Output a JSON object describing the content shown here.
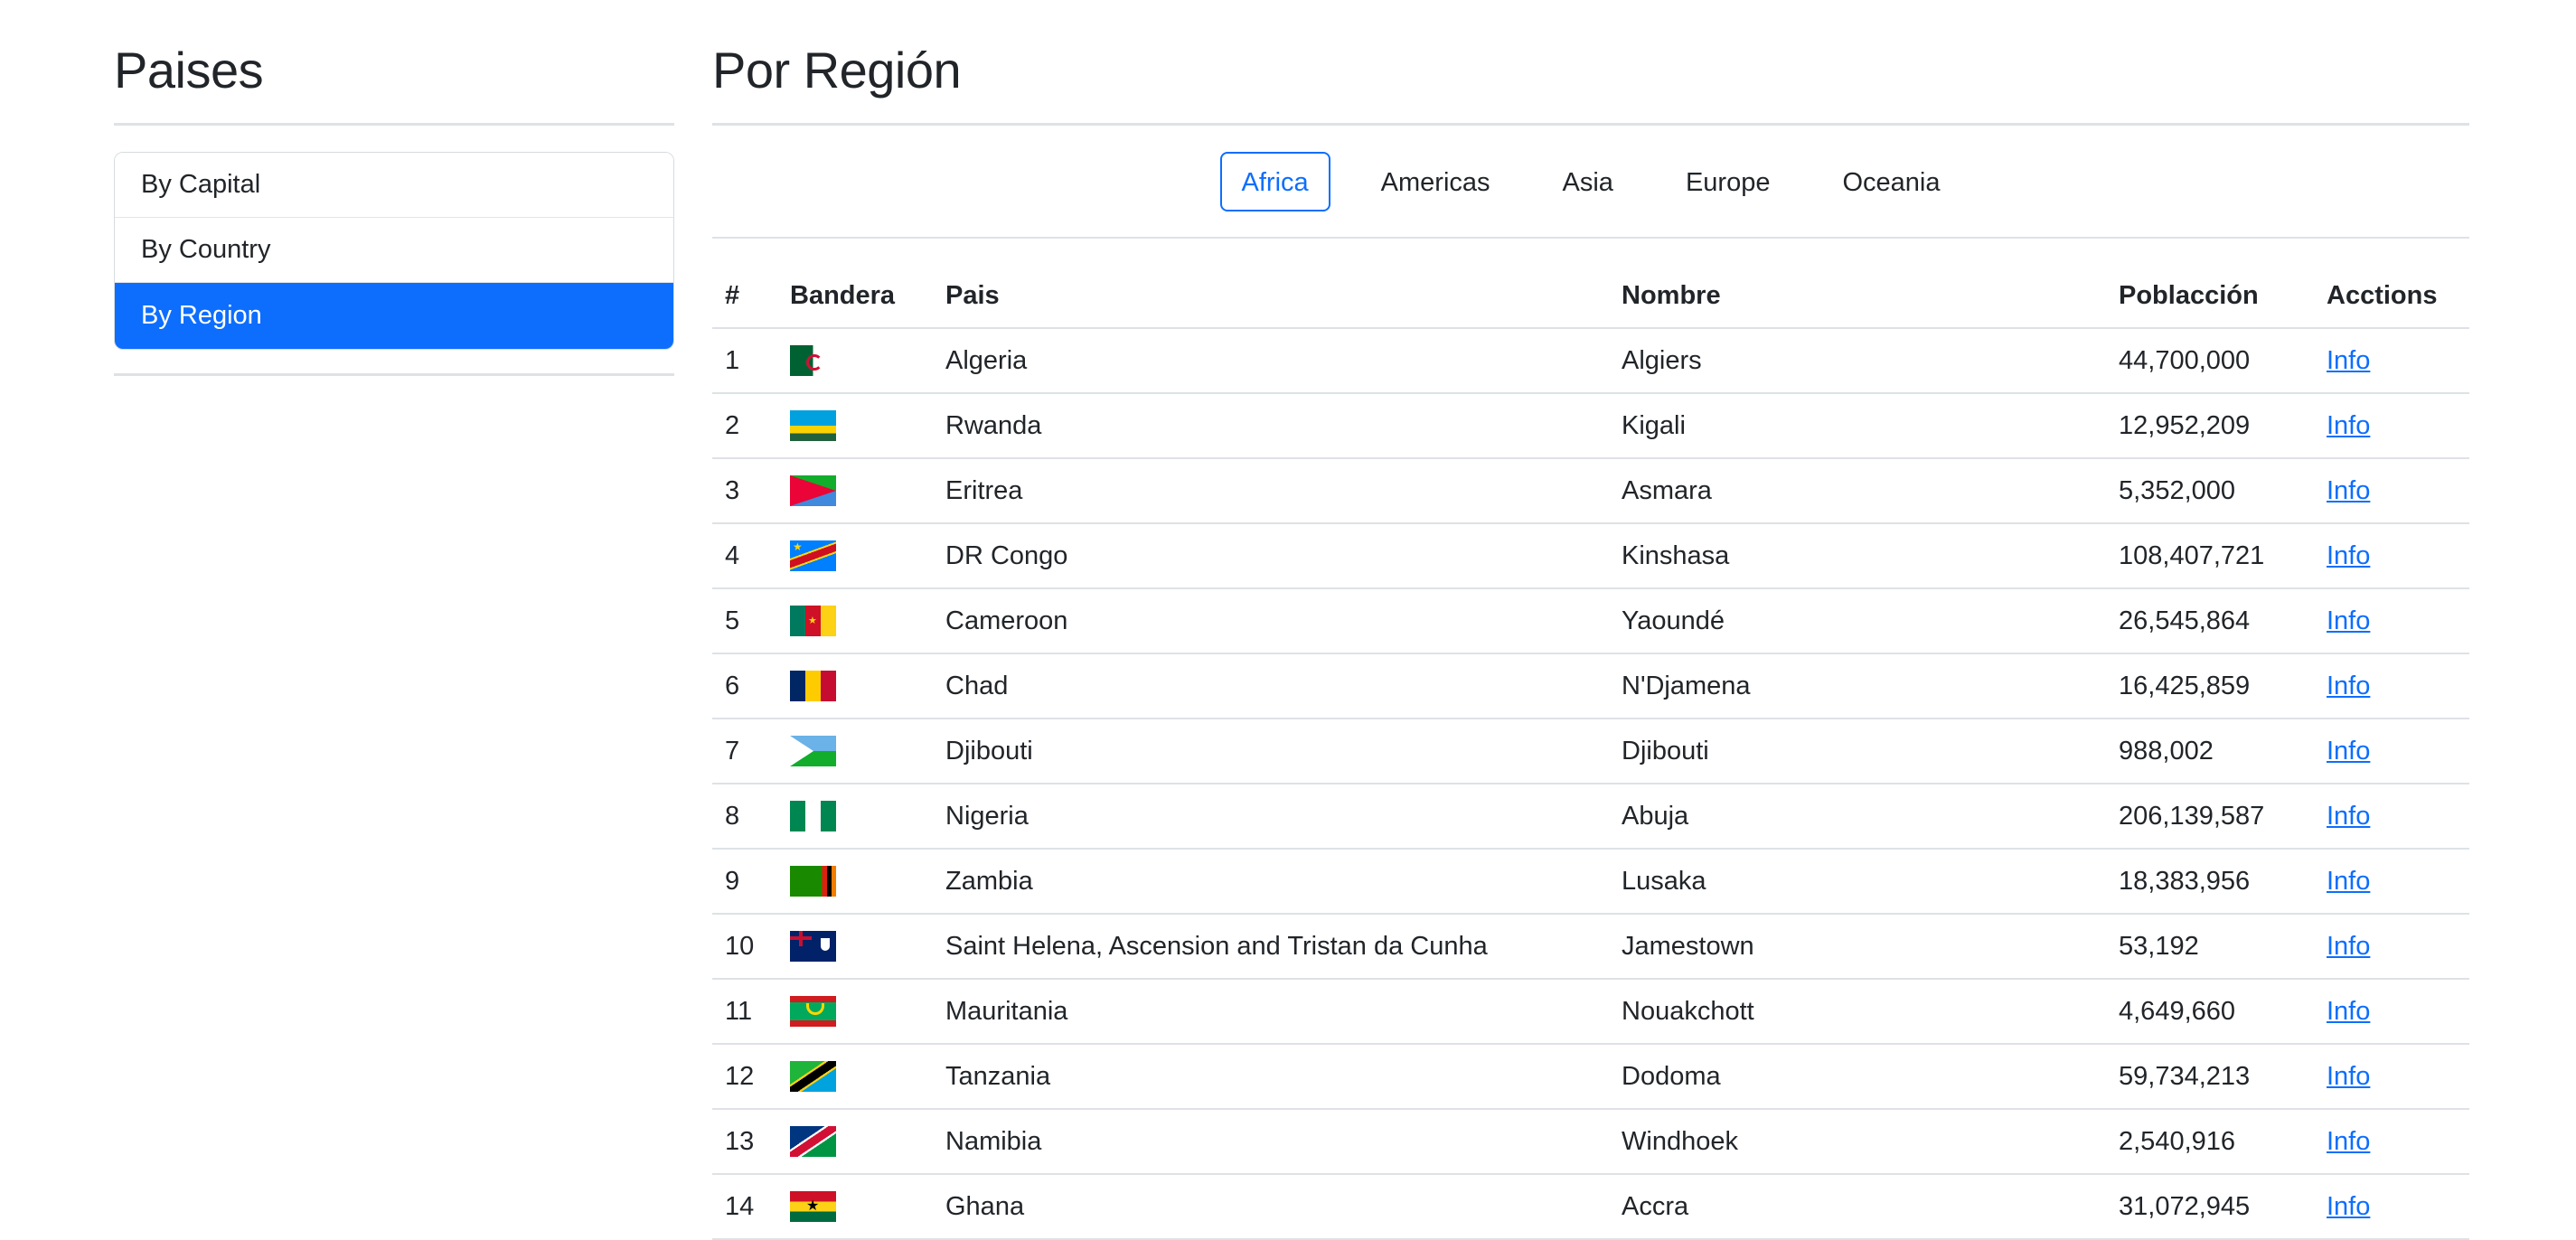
{
  "sidebar": {
    "title": "Paises",
    "items": [
      {
        "label": "By Capital",
        "active": false
      },
      {
        "label": "By Country",
        "active": false
      },
      {
        "label": "By Region",
        "active": true
      }
    ]
  },
  "main": {
    "title": "Por Región",
    "regions": [
      {
        "label": "Africa",
        "active": true
      },
      {
        "label": "Americas",
        "active": false
      },
      {
        "label": "Asia",
        "active": false
      },
      {
        "label": "Europe",
        "active": false
      },
      {
        "label": "Oceania",
        "active": false
      }
    ],
    "table": {
      "headers": {
        "index": "#",
        "flag": "Bandera",
        "country": "Pais",
        "name": "Nombre",
        "population": "Poblacción",
        "actions": "Acctions"
      },
      "rows": [
        {
          "index": "1",
          "flag": "algeria-flag",
          "country": "Algeria",
          "name": "Algiers",
          "population": "44,700,000",
          "action": "Info"
        },
        {
          "index": "2",
          "flag": "rwanda-flag",
          "country": "Rwanda",
          "name": "Kigali",
          "population": "12,952,209",
          "action": "Info"
        },
        {
          "index": "3",
          "flag": "eritrea-flag",
          "country": "Eritrea",
          "name": "Asmara",
          "population": "5,352,000",
          "action": "Info"
        },
        {
          "index": "4",
          "flag": "dr-congo-flag",
          "country": "DR Congo",
          "name": "Kinshasa",
          "population": "108,407,721",
          "action": "Info"
        },
        {
          "index": "5",
          "flag": "cameroon-flag",
          "country": "Cameroon",
          "name": "Yaoundé",
          "population": "26,545,864",
          "action": "Info"
        },
        {
          "index": "6",
          "flag": "chad-flag",
          "country": "Chad",
          "name": "N'Djamena",
          "population": "16,425,859",
          "action": "Info"
        },
        {
          "index": "7",
          "flag": "djibouti-flag",
          "country": "Djibouti",
          "name": "Djibouti",
          "population": "988,002",
          "action": "Info"
        },
        {
          "index": "8",
          "flag": "nigeria-flag",
          "country": "Nigeria",
          "name": "Abuja",
          "population": "206,139,587",
          "action": "Info"
        },
        {
          "index": "9",
          "flag": "zambia-flag",
          "country": "Zambia",
          "name": "Lusaka",
          "population": "18,383,956",
          "action": "Info"
        },
        {
          "index": "10",
          "flag": "saint-helena-flag",
          "country": "Saint Helena, Ascension and Tristan da Cunha",
          "name": "Jamestown",
          "population": "53,192",
          "action": "Info"
        },
        {
          "index": "11",
          "flag": "mauritania-flag",
          "country": "Mauritania",
          "name": "Nouakchott",
          "population": "4,649,660",
          "action": "Info"
        },
        {
          "index": "12",
          "flag": "tanzania-flag",
          "country": "Tanzania",
          "name": "Dodoma",
          "population": "59,734,213",
          "action": "Info"
        },
        {
          "index": "13",
          "flag": "namibia-flag",
          "country": "Namibia",
          "name": "Windhoek",
          "population": "2,540,916",
          "action": "Info"
        },
        {
          "index": "14",
          "flag": "ghana-flag",
          "country": "Ghana",
          "name": "Accra",
          "population": "31,072,945",
          "action": "Info"
        }
      ]
    }
  },
  "colors": {
    "accent": "#0d6efd",
    "text": "#212529",
    "divider": "#dee2e6"
  }
}
